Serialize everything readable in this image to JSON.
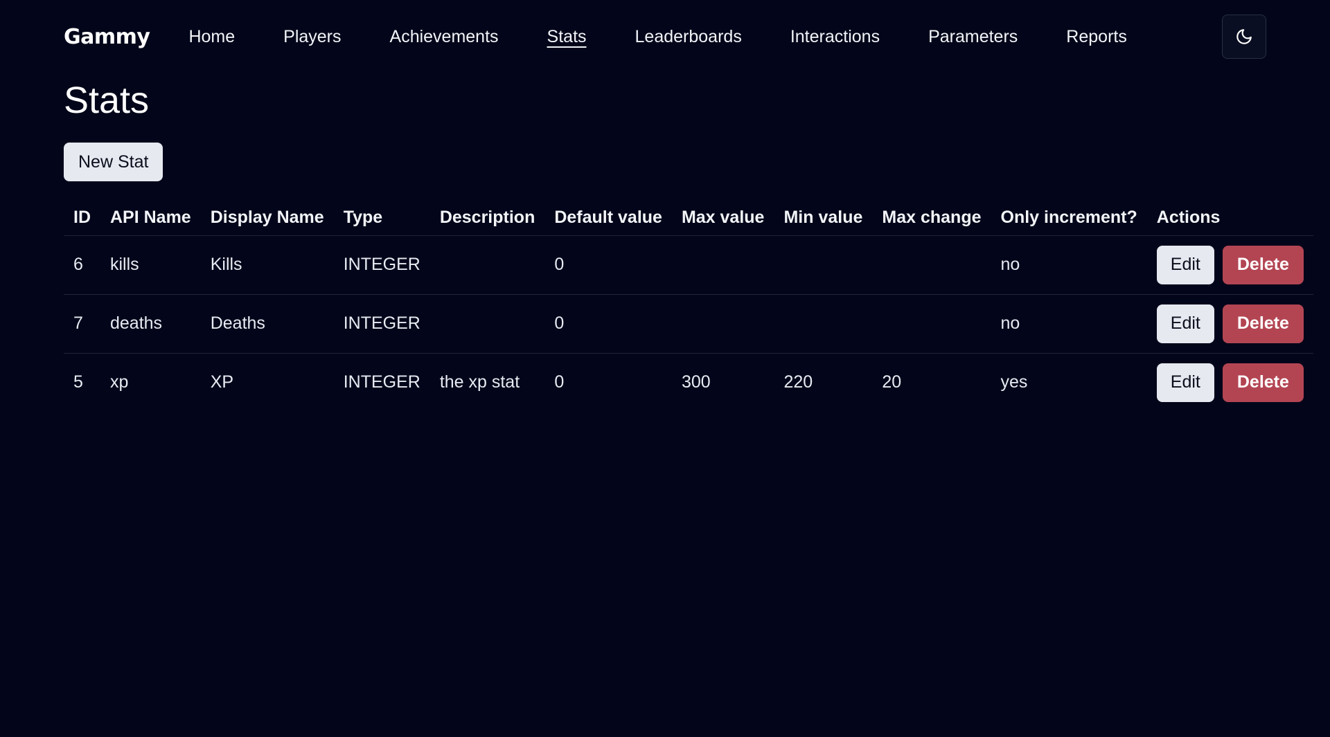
{
  "nav": {
    "brand": "Gammy",
    "links": [
      {
        "label": "Home",
        "active": false
      },
      {
        "label": "Players",
        "active": false
      },
      {
        "label": "Achievements",
        "active": false
      },
      {
        "label": "Stats",
        "active": true
      },
      {
        "label": "Leaderboards",
        "active": false
      },
      {
        "label": "Interactions",
        "active": false
      },
      {
        "label": "Parameters",
        "active": false
      },
      {
        "label": "Reports",
        "active": false
      }
    ],
    "theme_toggle_icon": "moon-icon"
  },
  "page": {
    "title": "Stats",
    "new_button_label": "New Stat"
  },
  "table": {
    "headers": [
      "ID",
      "API Name",
      "Display Name",
      "Type",
      "Description",
      "Default value",
      "Max value",
      "Min value",
      "Max change",
      "Only increment?",
      "Actions"
    ],
    "rows": [
      {
        "id": "6",
        "api_name": "kills",
        "display_name": "Kills",
        "type": "INTEGER",
        "description": "",
        "default_value": "0",
        "max_value": "",
        "min_value": "",
        "max_change": "",
        "only_increment": "no"
      },
      {
        "id": "7",
        "api_name": "deaths",
        "display_name": "Deaths",
        "type": "INTEGER",
        "description": "",
        "default_value": "0",
        "max_value": "",
        "min_value": "",
        "max_change": "",
        "only_increment": "no"
      },
      {
        "id": "5",
        "api_name": "xp",
        "display_name": "XP",
        "type": "INTEGER",
        "description": "the xp stat",
        "default_value": "0",
        "max_value": "300",
        "min_value": "220",
        "max_change": "20",
        "only_increment": "yes"
      }
    ],
    "edit_label": "Edit",
    "delete_label": "Delete"
  },
  "colors": {
    "background": "#03061a",
    "delete_button": "#b34553",
    "light_button": "#e6e9f0"
  }
}
